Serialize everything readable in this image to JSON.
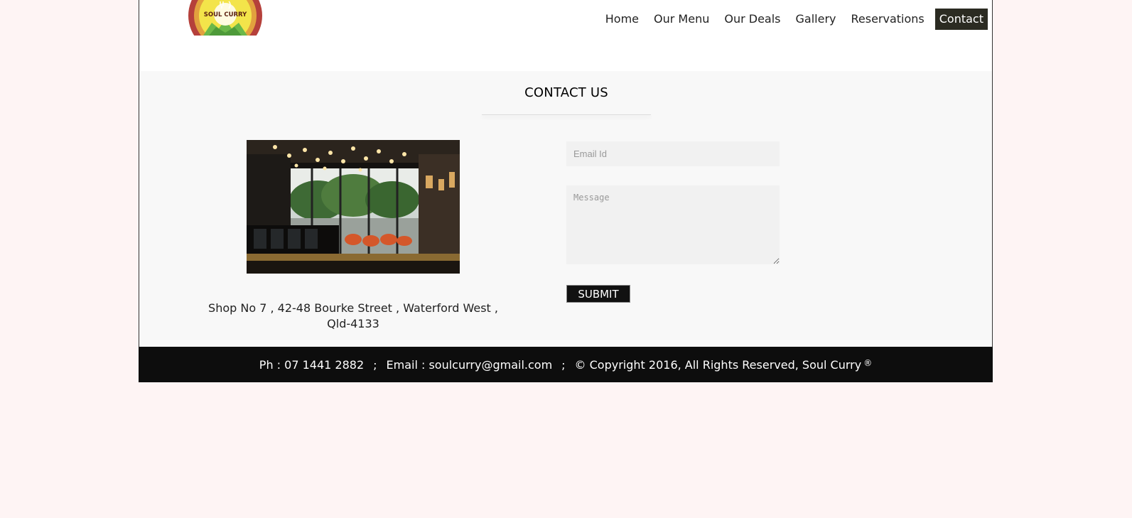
{
  "logo": {
    "text": "SOUL CURRY"
  },
  "nav": {
    "items": [
      {
        "label": "Home"
      },
      {
        "label": "Our Menu"
      },
      {
        "label": "Our Deals"
      },
      {
        "label": "Gallery"
      },
      {
        "label": "Reservations"
      },
      {
        "label": "Contact"
      }
    ]
  },
  "contact": {
    "heading": "CONTACT US",
    "address_line1": "Shop No 7 , 42-48 Bourke Street , Waterford West ,",
    "address_line2": "Qld-4133",
    "email_placeholder": "Email Id",
    "message_placeholder": "Message",
    "submit_label": "SUBMIT"
  },
  "footer": {
    "phone": "Ph : 07 1441 2882",
    "separator": ";",
    "email": "Email : soulcurry@gmail.com",
    "copyright": "© Copyright 2016,  All Rights Reserved,  Soul Curry",
    "registered_mark": "®"
  },
  "colors": {
    "page_background": "#fef4f4",
    "active_nav": "#2b2b22",
    "footer_background": "#0d0d0d",
    "logo_red": "#b5403b",
    "logo_yellow": "#f3e44a"
  }
}
